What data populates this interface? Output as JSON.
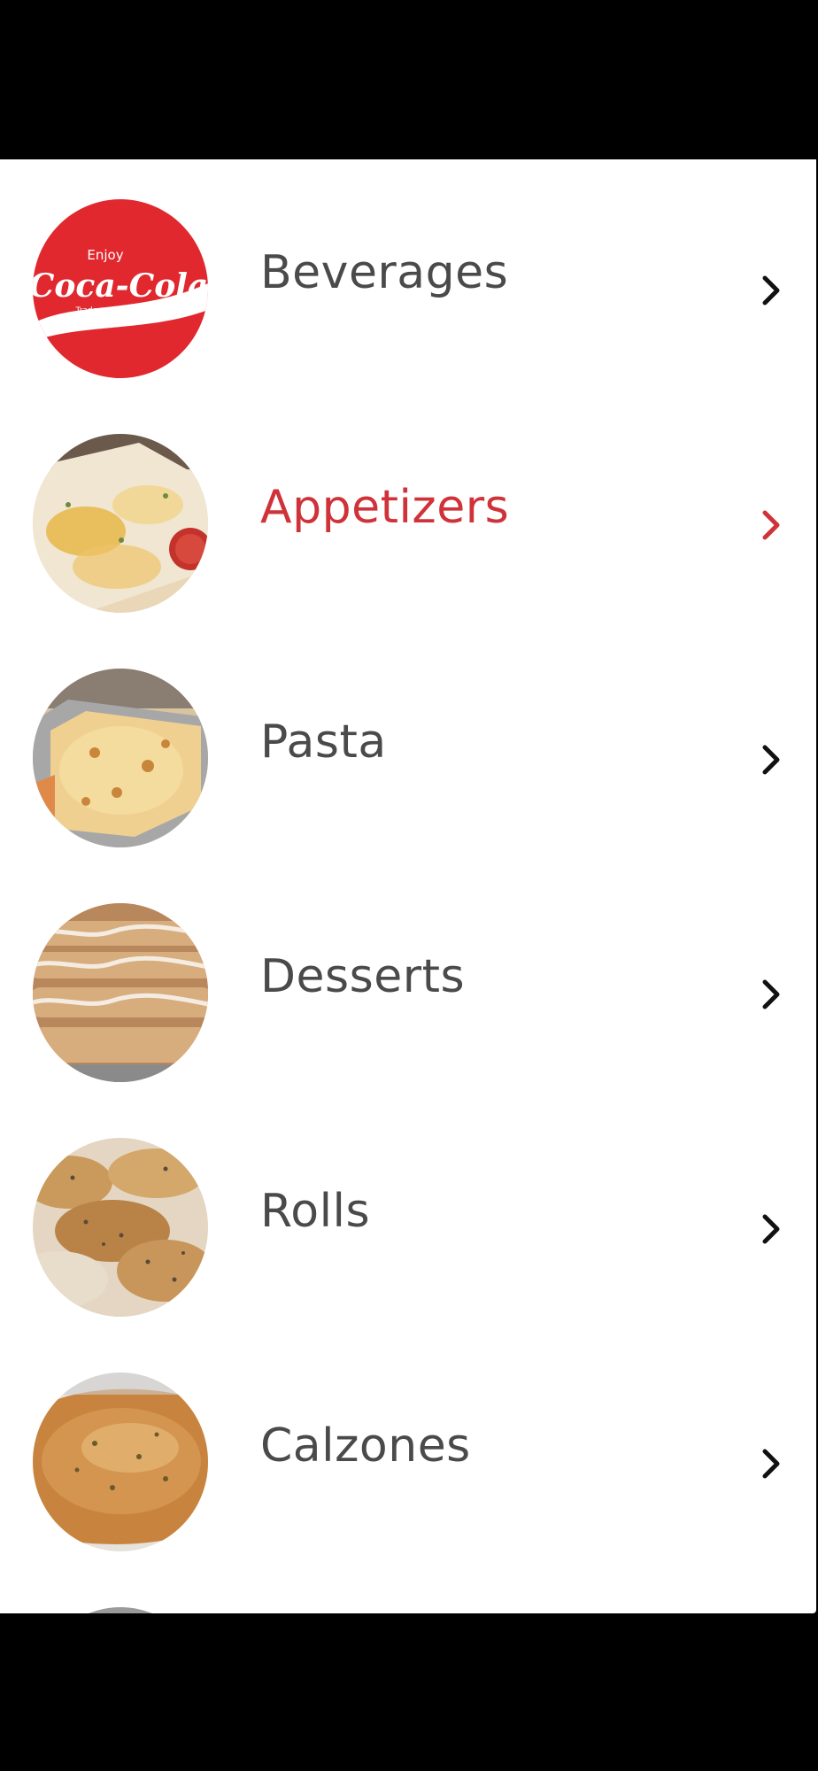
{
  "colors": {
    "text": "#4a4a4a",
    "active": "#cf3339",
    "chevron": "#111111",
    "coke_red": "#e0282e"
  },
  "thumbnail_badge": {
    "line1": "Enjoy",
    "wordmark": "Coca-Cola",
    "line3": "Trade-mark ®"
  },
  "categories": [
    {
      "label": "Beverages",
      "image": "coca-cola-logo",
      "active": false
    },
    {
      "label": "Appetizers",
      "image": "cheesy-bread-photo",
      "active": true
    },
    {
      "label": "Pasta",
      "image": "baked-pasta-tray-photo",
      "active": false
    },
    {
      "label": "Desserts",
      "image": "dessert-pastries-photo",
      "active": false
    },
    {
      "label": "Rolls",
      "image": "rolls-photo",
      "active": false
    },
    {
      "label": "Calzones",
      "image": "calzone-photo",
      "active": false
    }
  ],
  "chevron_icon": "chevron-right-icon"
}
